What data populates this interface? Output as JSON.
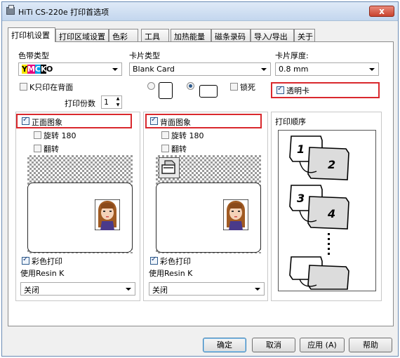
{
  "window": {
    "title": "HiTi CS-220e 打印首选项",
    "close_label": "x"
  },
  "tabs": [
    {
      "label": "打印机设置",
      "active": true
    },
    {
      "label": "打印区域设置",
      "active": false
    },
    {
      "label": "色彩",
      "active": false
    },
    {
      "label": "工具",
      "active": false
    },
    {
      "label": "加热能量",
      "active": false
    },
    {
      "label": "磁条录码",
      "active": false
    },
    {
      "label": "导入/导出",
      "active": false
    },
    {
      "label": "关于",
      "active": false
    }
  ],
  "ribbon": {
    "label": "色带类型",
    "value_parts": {
      "y": "Y",
      "m": "M",
      "c": "C",
      "k": "K",
      "o": "O"
    }
  },
  "card_type": {
    "label": "卡片类型",
    "value": "Blank Card"
  },
  "card_thickness": {
    "label": "卡片厚度:",
    "value": "0.8 mm"
  },
  "options": {
    "k_only_back": {
      "label": "K只印在背面",
      "checked": false
    },
    "lock": {
      "label": "锁死",
      "checked": false
    },
    "transparent": {
      "label": "透明卡",
      "checked": true
    },
    "orientation": {
      "portrait_checked": false,
      "landscape_checked": true
    }
  },
  "copies": {
    "label": "打印份数",
    "value": "1"
  },
  "front": {
    "title": "正面图象",
    "checked": true,
    "rotate": {
      "label": "旋转 180",
      "checked": false
    },
    "flip": {
      "label": "翻转",
      "checked": false
    },
    "color_print": {
      "label": "彩色打印",
      "checked": true
    },
    "resin_label": "使用Resin K",
    "resin_value": "关闭"
  },
  "back": {
    "title": "背面图象",
    "checked": true,
    "rotate": {
      "label": "旋转 180",
      "checked": false
    },
    "flip": {
      "label": "翻转",
      "checked": false
    },
    "color_print": {
      "label": "彩色打印",
      "checked": true
    },
    "resin_label": "使用Resin K",
    "resin_value": "关闭"
  },
  "print_order": {
    "title": "打印顺序",
    "cards": [
      {
        "front": "1",
        "back": "2"
      },
      {
        "front": "3",
        "back": "4"
      }
    ]
  },
  "buttons": {
    "ok": "确定",
    "cancel": "取消",
    "apply": "应用 (A)",
    "help": "帮助"
  },
  "colors": {
    "highlight_box": "#d9282d",
    "ymcko_y": "#f5e600",
    "ymcko_m": "#e6007e",
    "ymcko_c": "#00a0e9",
    "ymcko_k": "#000000"
  }
}
